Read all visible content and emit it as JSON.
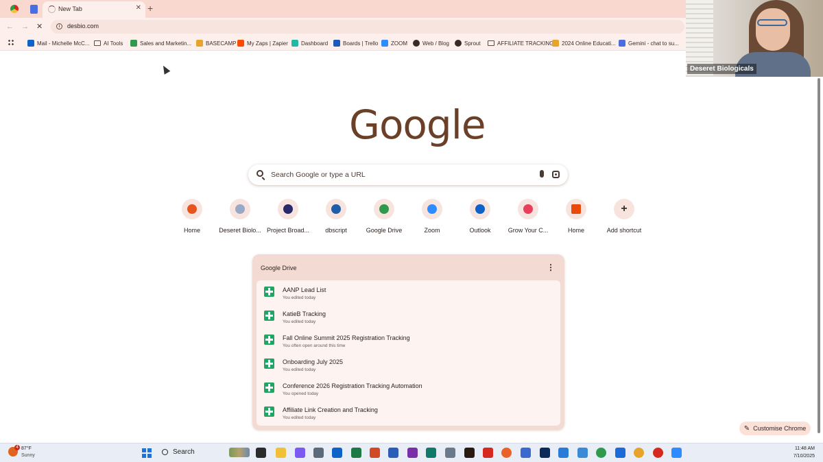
{
  "browser": {
    "active_tab_title": "New Tab",
    "url": "desbio.com",
    "bookmarks": [
      {
        "label": "Mail - Michelle McC...",
        "icon": "outlook-icon",
        "color": "#0f62c9"
      },
      {
        "label": "AI Tools",
        "icon": "folder-icon"
      },
      {
        "label": "Sales and Marketin...",
        "icon": "drive-icon",
        "color": "#2f9a4b"
      },
      {
        "label": "BASECAMP",
        "icon": "basecamp-icon",
        "color": "#e8a32a"
      },
      {
        "label": "My Zaps | Zapier",
        "icon": "zapier-icon",
        "color": "#ff4a00"
      },
      {
        "label": "Dashboard",
        "icon": "dashboard-icon",
        "color": "#20b9a8"
      },
      {
        "label": "Boards | Trello",
        "icon": "trello-icon",
        "color": "#1d5bb8"
      },
      {
        "label": "ZOOM",
        "icon": "zoom-icon",
        "color": "#2d8cff"
      },
      {
        "label": "Web / Blog",
        "icon": "infinity-icon"
      },
      {
        "label": "Sprout",
        "icon": "sprout-icon"
      },
      {
        "label": "AFFILIATE TRACKING",
        "icon": "folder-icon"
      },
      {
        "label": "2024 Online Educati...",
        "icon": "chrome-site-icon",
        "color": "#e8a32a"
      },
      {
        "label": "Gemini - chat to su...",
        "icon": "gemini-icon",
        "color": "#4a6ee0"
      }
    ]
  },
  "video": {
    "participant_name": "Deseret Biologicals"
  },
  "newtab": {
    "logo_text": "Google",
    "search_placeholder": "Search Google or type a URL",
    "shortcuts": [
      {
        "label": "Home",
        "icon": "home-site-icon",
        "color": "#e8541e"
      },
      {
        "label": "Deseret Biolo...",
        "icon": "deseret-icon",
        "color": "#9aa8c8"
      },
      {
        "label": "Project Broad...",
        "icon": "project-icon",
        "color": "#2a2a6a"
      },
      {
        "label": "dbscript",
        "icon": "dbscript-icon",
        "color": "#1f5ea8"
      },
      {
        "label": "Google Drive",
        "icon": "drive-icon",
        "color": "#2f9a4b"
      },
      {
        "label": "Zoom",
        "icon": "zoom-icon",
        "color": "#2d8cff"
      },
      {
        "label": "Outlook",
        "icon": "outlook-icon",
        "color": "#0f62c9"
      },
      {
        "label": "Grow Your C...",
        "icon": "grow-icon",
        "color": "#e8405a"
      },
      {
        "label": "Home",
        "icon": "home-orange-icon",
        "color": "#e84a0c"
      },
      {
        "label": "Add shortcut",
        "icon": "plus-icon",
        "color": "#3a2a25"
      }
    ],
    "drive_card": {
      "title": "Google Drive",
      "items": [
        {
          "name": "AANP Lead List",
          "sub": "You edited today"
        },
        {
          "name": "KatieB Tracking",
          "sub": "You edited today"
        },
        {
          "name": "Fall Online Summit 2025 Registration Tracking",
          "sub": "You often open around this time"
        },
        {
          "name": "Onboarding July 2025",
          "sub": "You edited today"
        },
        {
          "name": "Conference 2026 Registration Tracking Automation",
          "sub": "You opened today"
        },
        {
          "name": "Affiliate Link Creation and Tracking",
          "sub": "You edited today"
        }
      ]
    },
    "customise_label": "Customise Chrome"
  },
  "taskbar": {
    "weather_temp": "87°F",
    "weather_cond": "Sunny",
    "weather_badge": "4",
    "search_label": "Search",
    "time": "11:48 AM",
    "date": "7/10/2025",
    "apps": [
      {
        "name": "task-view-icon",
        "color": "#2b2b2b"
      },
      {
        "name": "file-explorer-icon",
        "color": "#f2c037"
      },
      {
        "name": "copilot-icon",
        "color": "#7a5af0"
      },
      {
        "name": "calculator-icon",
        "color": "#5a6a7a"
      },
      {
        "name": "outlook-taskbar-icon",
        "color": "#0f62c9"
      },
      {
        "name": "excel-icon",
        "color": "#1e7a44"
      },
      {
        "name": "powerpoint-icon",
        "color": "#d04a23"
      },
      {
        "name": "word-icon",
        "color": "#2a5cb8"
      },
      {
        "name": "onenote-icon",
        "color": "#7a2fa8"
      },
      {
        "name": "publisher-icon",
        "color": "#0f7a6a"
      },
      {
        "name": "camera-icon",
        "color": "#6a7a8a"
      },
      {
        "name": "illustrator-icon",
        "color": "#2a1a10"
      },
      {
        "name": "acrobat-icon",
        "color": "#d6281e"
      },
      {
        "name": "firefox-icon",
        "color": "#e8622a"
      },
      {
        "name": "snip-icon",
        "color": "#3a6ad0"
      },
      {
        "name": "photoshop-icon",
        "color": "#0a2a5a"
      },
      {
        "name": "notepad-icon",
        "color": "#2a7ad8"
      },
      {
        "name": "settings-app-icon",
        "color": "#3a8ad8"
      },
      {
        "name": "chrome-icon",
        "color": "#2f9a4b"
      },
      {
        "name": "store-icon",
        "color": "#1a6ad8"
      },
      {
        "name": "chrome-profile-icon",
        "color": "#e8a32a"
      },
      {
        "name": "chrome-alt-icon",
        "color": "#d6281e"
      },
      {
        "name": "zoom-taskbar-icon",
        "color": "#2d8cff"
      }
    ]
  }
}
